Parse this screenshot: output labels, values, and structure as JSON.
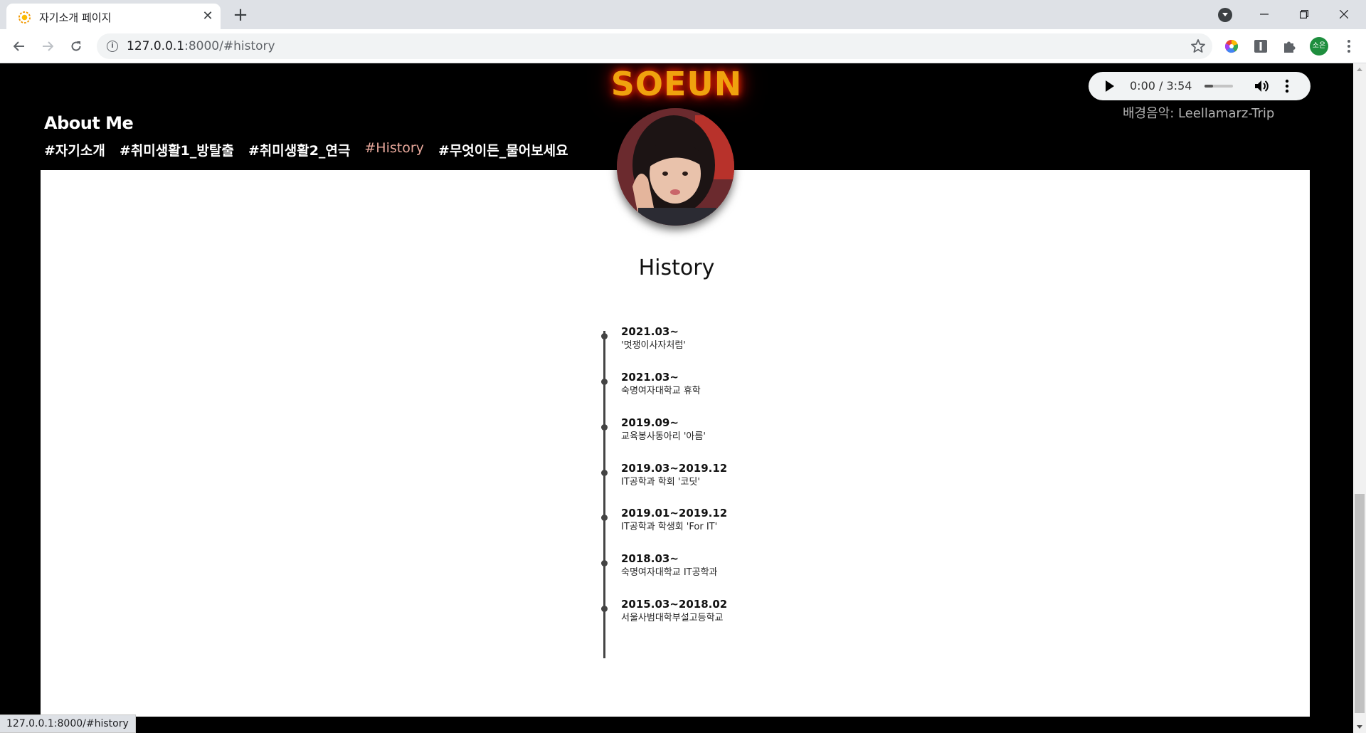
{
  "browser": {
    "tab_title": "자기소개 페이지",
    "url_host": "127.0.0.1",
    "url_path": ":8000/#history",
    "profile_initials": "소은",
    "status_url": "127.0.0.1:8000/#history"
  },
  "header": {
    "brand": "SOEUN",
    "about_title": "About Me",
    "nav": [
      {
        "label": "#자기소개",
        "active": false
      },
      {
        "label": "#취미생활1_방탈출",
        "active": false
      },
      {
        "label": "#취미생활2_연극",
        "active": false
      },
      {
        "label": "#History",
        "active": true
      },
      {
        "label": "#무엇이든_물어보세요",
        "active": false
      }
    ]
  },
  "audio": {
    "time": "0:00 / 3:54",
    "progress_fraction": 0.3,
    "caption": "배경음악: Leellamarz-Trip"
  },
  "history": {
    "title": "History",
    "items": [
      {
        "date": "2021.03~",
        "desc": "'멋쟁이사자처럼'"
      },
      {
        "date": "2021.03~",
        "desc": "숙명여자대학교 휴학"
      },
      {
        "date": "2019.09~",
        "desc": "교육봉사동아리 '아름'"
      },
      {
        "date": "2019.03~2019.12",
        "desc": "IT공학과 학회 '코딧'"
      },
      {
        "date": "2019.01~2019.12",
        "desc": "IT공학과 학생회 'For IT'"
      },
      {
        "date": "2018.03~",
        "desc": "숙명여자대학교 IT공학과"
      },
      {
        "date": "2015.03~2018.02",
        "desc": "서울사범대학부설고등학교"
      }
    ]
  },
  "colors": {
    "brand": "#f0a20e",
    "nav_active": "#e8a89b",
    "page_bg": "#000000",
    "content_bg": "#ffffff"
  }
}
